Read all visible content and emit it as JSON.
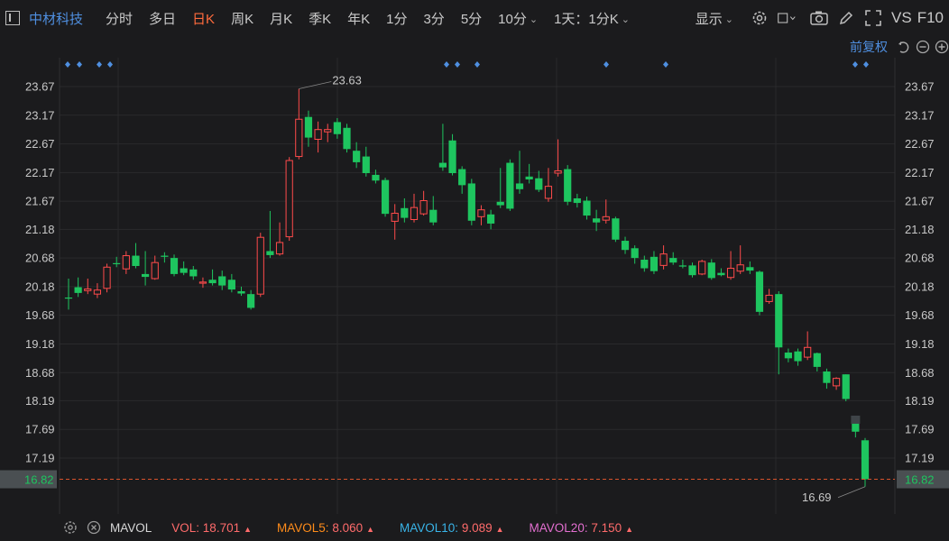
{
  "toolbar": {
    "stock_name": "中材科技",
    "tabs": [
      {
        "label": "分时",
        "active": false
      },
      {
        "label": "多日",
        "active": false
      },
      {
        "label": "日K",
        "active": true
      },
      {
        "label": "周K",
        "active": false
      },
      {
        "label": "月K",
        "active": false
      },
      {
        "label": "季K",
        "active": false
      },
      {
        "label": "年K",
        "active": false
      },
      {
        "label": "1分",
        "active": false
      },
      {
        "label": "3分",
        "active": false
      },
      {
        "label": "5分",
        "active": false
      },
      {
        "label": "10分",
        "active": false
      }
    ],
    "period_select": "1天：1分K",
    "display_select": "显示",
    "vs_label": "VS",
    "f10_label": "F10",
    "icons": [
      "layout-icon",
      "settings-icon",
      "crosshair-icon",
      "camera-icon",
      "draw-icon",
      "fullscreen-icon"
    ]
  },
  "subbar": {
    "adjust_label": "前复权",
    "icons": [
      "undo-icon",
      "zoom-out-icon",
      "zoom-in-icon"
    ]
  },
  "colors": {
    "up": "#ff4b4b",
    "down": "#1ec55f",
    "accent": "#4f8fe0",
    "active_tab": "#ff6b3d",
    "last_price_line": "#d9532c"
  },
  "chart_data": {
    "type": "candlestick",
    "y_ticks": [
      "23.67",
      "23.17",
      "22.67",
      "22.17",
      "21.67",
      "21.18",
      "20.68",
      "20.18",
      "19.68",
      "19.18",
      "18.68",
      "18.19",
      "17.69",
      "17.19"
    ],
    "ylim": [
      16.56,
      23.85
    ],
    "last_price": "16.82",
    "max_label": "23.63",
    "min_label": "16.69",
    "candles": [
      [
        19.99,
        19.98,
        20.32,
        19.78
      ],
      [
        20.17,
        20.07,
        20.34,
        20.0
      ],
      [
        20.11,
        20.14,
        20.32,
        20.05
      ],
      [
        20.05,
        20.12,
        20.24,
        19.98
      ],
      [
        20.15,
        20.52,
        20.58,
        20.08
      ],
      [
        20.59,
        20.58,
        20.7,
        20.52
      ],
      [
        20.49,
        20.72,
        20.8,
        20.4
      ],
      [
        20.72,
        20.54,
        20.94,
        20.5
      ],
      [
        20.4,
        20.35,
        20.8,
        20.2
      ],
      [
        20.32,
        20.6,
        20.72,
        20.3
      ],
      [
        20.72,
        20.7,
        20.78,
        20.6
      ],
      [
        20.68,
        20.4,
        20.74,
        20.36
      ],
      [
        20.5,
        20.42,
        20.62,
        20.38
      ],
      [
        20.48,
        20.36,
        20.54,
        20.3
      ],
      [
        20.24,
        20.26,
        20.34,
        20.16
      ],
      [
        20.3,
        20.24,
        20.48,
        20.2
      ],
      [
        20.36,
        20.2,
        20.46,
        20.12
      ],
      [
        20.3,
        20.13,
        20.4,
        20.08
      ],
      [
        20.1,
        20.06,
        20.18,
        20.02
      ],
      [
        20.05,
        19.81,
        20.12,
        19.78
      ],
      [
        20.05,
        21.04,
        21.12,
        20.0
      ],
      [
        20.8,
        20.73,
        21.5,
        20.68
      ],
      [
        20.75,
        20.95,
        21.3,
        20.72
      ],
      [
        21.05,
        22.38,
        22.44,
        20.98
      ],
      [
        22.45,
        23.1,
        23.63,
        22.4
      ],
      [
        23.14,
        22.78,
        23.25,
        22.62
      ],
      [
        22.75,
        22.92,
        23.06,
        22.52
      ],
      [
        22.88,
        22.92,
        23.02,
        22.7
      ],
      [
        23.05,
        22.84,
        23.12,
        22.76
      ],
      [
        22.95,
        22.58,
        23.02,
        22.52
      ],
      [
        22.55,
        22.35,
        22.7,
        22.25
      ],
      [
        22.45,
        22.16,
        22.62,
        22.1
      ],
      [
        22.13,
        22.03,
        22.22,
        21.98
      ],
      [
        22.04,
        21.45,
        22.08,
        21.4
      ],
      [
        21.32,
        21.46,
        21.62,
        21.0
      ],
      [
        21.55,
        21.38,
        21.72,
        21.3
      ],
      [
        21.35,
        21.56,
        21.8,
        21.3
      ],
      [
        21.45,
        21.68,
        21.85,
        21.42
      ],
      [
        21.52,
        21.3,
        21.76,
        21.25
      ],
      [
        22.34,
        22.26,
        23.02,
        22.2
      ],
      [
        22.73,
        22.16,
        22.84,
        22.12
      ],
      [
        22.23,
        21.95,
        22.28,
        21.8
      ],
      [
        21.98,
        21.33,
        22.06,
        21.25
      ],
      [
        21.4,
        21.52,
        21.6,
        21.25
      ],
      [
        21.44,
        21.28,
        21.52,
        21.18
      ],
      [
        21.66,
        21.6,
        22.25,
        21.55
      ],
      [
        22.34,
        21.54,
        22.4,
        21.5
      ],
      [
        21.98,
        21.88,
        22.55,
        21.8
      ],
      [
        22.1,
        22.05,
        22.32,
        21.98
      ],
      [
        22.07,
        21.87,
        22.2,
        21.83
      ],
      [
        21.72,
        21.93,
        22.25,
        21.66
      ],
      [
        22.16,
        22.2,
        22.75,
        22.1
      ],
      [
        22.23,
        21.66,
        22.3,
        21.6
      ],
      [
        21.72,
        21.64,
        21.8,
        21.56
      ],
      [
        21.68,
        21.42,
        21.75,
        21.35
      ],
      [
        21.37,
        21.3,
        21.52,
        21.15
      ],
      [
        21.34,
        21.4,
        21.7,
        21.28
      ],
      [
        21.37,
        21.0,
        21.4,
        20.96
      ],
      [
        20.98,
        20.82,
        21.05,
        20.75
      ],
      [
        20.85,
        20.68,
        20.9,
        20.58
      ],
      [
        20.65,
        20.5,
        20.72,
        20.44
      ],
      [
        20.7,
        20.45,
        20.8,
        20.4
      ],
      [
        20.55,
        20.75,
        20.9,
        20.48
      ],
      [
        20.68,
        20.6,
        20.78,
        20.56
      ],
      [
        20.55,
        20.53,
        20.65,
        20.5
      ],
      [
        20.55,
        20.38,
        20.6,
        20.34
      ],
      [
        20.4,
        20.62,
        20.65,
        20.38
      ],
      [
        20.6,
        20.33,
        20.66,
        20.3
      ],
      [
        20.42,
        20.38,
        20.5,
        20.36
      ],
      [
        20.34,
        20.5,
        20.8,
        20.3
      ],
      [
        20.45,
        20.56,
        20.9,
        20.4
      ],
      [
        20.52,
        20.46,
        20.62,
        20.4
      ],
      [
        20.44,
        19.74,
        20.46,
        19.68
      ],
      [
        19.92,
        20.03,
        20.14,
        19.88
      ],
      [
        20.05,
        19.12,
        20.1,
        18.65
      ],
      [
        19.03,
        18.93,
        19.1,
        18.86
      ],
      [
        19.05,
        18.88,
        19.1,
        18.8
      ],
      [
        18.95,
        19.12,
        19.4,
        18.9
      ],
      [
        19.02,
        18.78,
        19.03,
        18.7
      ],
      [
        18.7,
        18.5,
        18.75,
        18.4
      ],
      [
        18.45,
        18.58,
        18.6,
        18.38
      ],
      [
        18.65,
        18.22,
        18.65,
        18.18
      ],
      [
        17.81,
        17.65,
        17.84,
        17.55
      ],
      [
        17.5,
        16.82,
        17.54,
        16.69
      ]
    ]
  },
  "volume": {
    "label": "MAVOL",
    "items": [
      {
        "name": "VOL:",
        "value": "18.701",
        "color": "#ff6b6b"
      },
      {
        "name": "MAVOL5:",
        "value": "8.060",
        "color": "#ff8c1a"
      },
      {
        "name": "MAVOL10:",
        "value": "9.089",
        "color": "#39b4e8"
      },
      {
        "name": "MAVOL20:",
        "value": "7.150",
        "color": "#e36fd0"
      }
    ],
    "icons": [
      "settings-icon",
      "close-icon"
    ]
  }
}
